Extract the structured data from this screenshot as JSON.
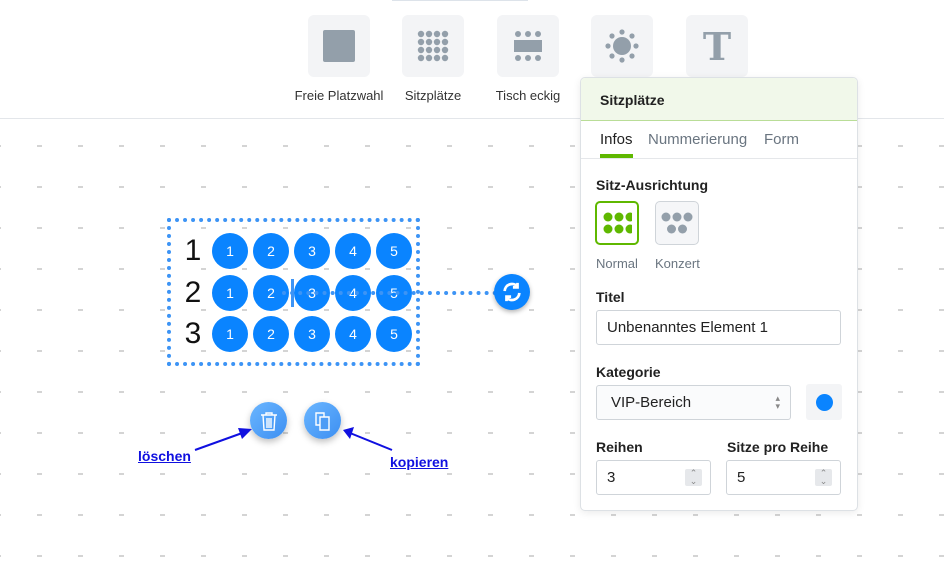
{
  "toolbar": {
    "items": [
      {
        "label": "Freie Platzwahl",
        "icon": "square-icon"
      },
      {
        "label": "Sitzplätze",
        "icon": "seat-grid-icon"
      },
      {
        "label": "Tisch eckig",
        "icon": "rect-table-icon"
      },
      {
        "label": "",
        "icon": "round-table-icon"
      },
      {
        "label": "",
        "icon": "text-icon"
      }
    ]
  },
  "canvas": {
    "rows": [
      "1",
      "2",
      "3"
    ],
    "seats": [
      "1",
      "2",
      "3",
      "4",
      "5"
    ],
    "seat_color": "#0a84ff",
    "annotations": {
      "delete": "löschen",
      "copy": "kopieren"
    }
  },
  "panel": {
    "title": "Sitzplätze",
    "tabs": [
      "Infos",
      "Nummerierung",
      "Form"
    ],
    "active_tab": "Infos",
    "orientation_label": "Sitz-Ausrichtung",
    "orientations": [
      "Normal",
      "Konzert"
    ],
    "selected_orientation": "Normal",
    "title_label": "Titel",
    "title_value": "Unbenanntes Element 1",
    "category_label": "Kategorie",
    "category_value": "VIP-Bereich",
    "category_color": "#0a84ff",
    "rows_label": "Reihen",
    "rows_value": "3",
    "seats_label": "Sitze pro Reihe",
    "seats_value": "5",
    "accent": "#5fb800"
  }
}
